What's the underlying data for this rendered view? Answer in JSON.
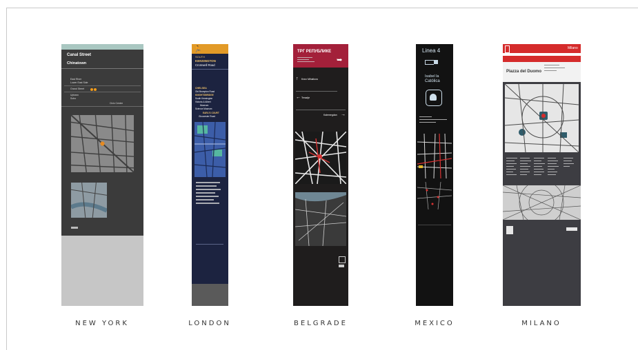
{
  "captions": {
    "new_york": "NEW YORK",
    "london": "LONDON",
    "belgrade": "BELGRADE",
    "mexico": "MEXICO",
    "milano": "MILANO"
  },
  "new_york": {
    "street": "Canal Street",
    "area": "Chinatown",
    "dir1a": "East River",
    "dir1b": "Lower East Side",
    "dir2": "Grand Street",
    "dir3a": "Uptown",
    "dir3b": "Soho",
    "civic": "Civic Center"
  },
  "london": {
    "area_top": "SOUTH",
    "area": "KENSINGTON",
    "road": "Cromwell Road",
    "chelsea": "CHELSEA",
    "chelsea_sub": "Old Brompton Road",
    "knights": "KNIGHTSBRIDGE",
    "museums_a": "South Kensington",
    "museums_b": "Victoria & Albert",
    "museums_c": "Museum",
    "museums_d": "Science Museum",
    "earls": "EARL'S COURT",
    "earls_sub": "Gloucester Road"
  },
  "belgrade": {
    "title": "ТРГ РЕПУБЛИКЕ",
    "sub1": "Knez Mihailova",
    "sub2": "Terazije",
    "sub3": "Kalemegdan"
  },
  "mexico": {
    "line": "Linea 4",
    "station_a": "Isabel la",
    "station_b": "Católica"
  },
  "milano": {
    "brand": "Milano",
    "place": "Piazza del Duomo"
  },
  "colors": {
    "ny_top": "#a9c7c1",
    "ny_body": "#3b3b3b",
    "ny_foot": "#c6c6c6",
    "london_top": "#e29a27",
    "london_body": "#1c2340",
    "belgrade_top": "#a3203a",
    "belgrade_body": "#1f1d1d",
    "mexico_body": "#121212",
    "milano_top": "#d52b2b",
    "milano_body": "#3d3d42"
  }
}
